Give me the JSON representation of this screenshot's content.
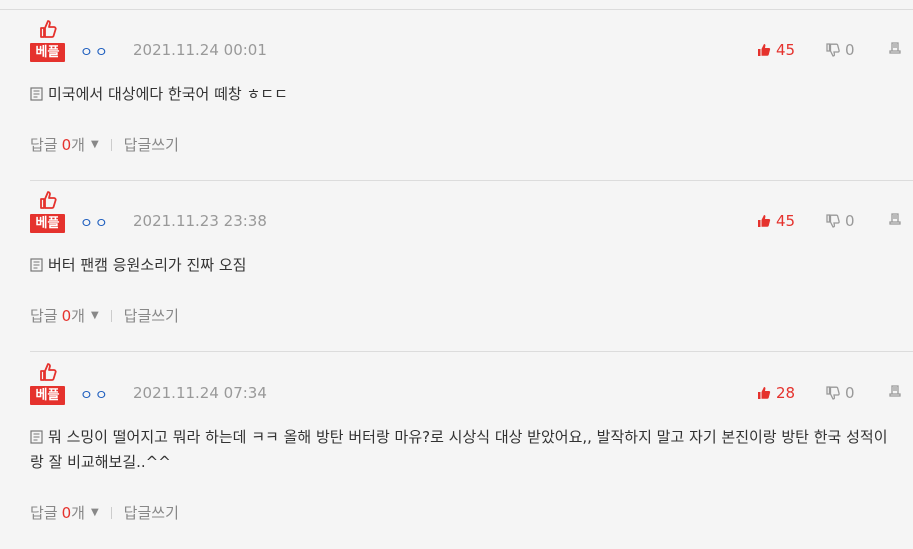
{
  "comments": [
    {
      "best_label": "베플",
      "author": "ㅇㅇ",
      "date": "2021.11.24 00:01",
      "likes": "45",
      "dislikes": "0",
      "text": "미국에서 대상에다 한국어 떼창 ㅎㄷㄷ",
      "reply_label": "답글",
      "reply_count": "0",
      "reply_unit": "개",
      "write_reply": "답글쓰기"
    },
    {
      "best_label": "베플",
      "author": "ㅇㅇ",
      "date": "2021.11.23 23:38",
      "likes": "45",
      "dislikes": "0",
      "text": "버터 팬캠 응원소리가 진짜 오짐",
      "reply_label": "답글",
      "reply_count": "0",
      "reply_unit": "개",
      "write_reply": "답글쓰기"
    },
    {
      "best_label": "베플",
      "author": "ㅇㅇ",
      "date": "2021.11.24 07:34",
      "likes": "28",
      "dislikes": "0",
      "text": "뭐 스밍이 떨어지고 뭐라 하는데 ㅋㅋ 올해 방탄 버터랑 마유?로 시상식 대상 받았어요,, 발작하지 말고 자기 본진이랑 방탄 한국 성적이랑 잘 비교해보길..^^",
      "reply_label": "답글",
      "reply_count": "0",
      "reply_unit": "개",
      "write_reply": "답글쓰기"
    }
  ],
  "colors": {
    "accent": "#e5322d",
    "muted": "#999999",
    "author": "#1f5fbf",
    "background": "#f5f5f5"
  },
  "icons": {
    "best": "thumbs-up-icon",
    "like": "thumbs-up-icon",
    "dislike": "thumbs-down-icon",
    "report": "report-icon",
    "doc": "document-icon",
    "caret": "caret-down-icon"
  }
}
